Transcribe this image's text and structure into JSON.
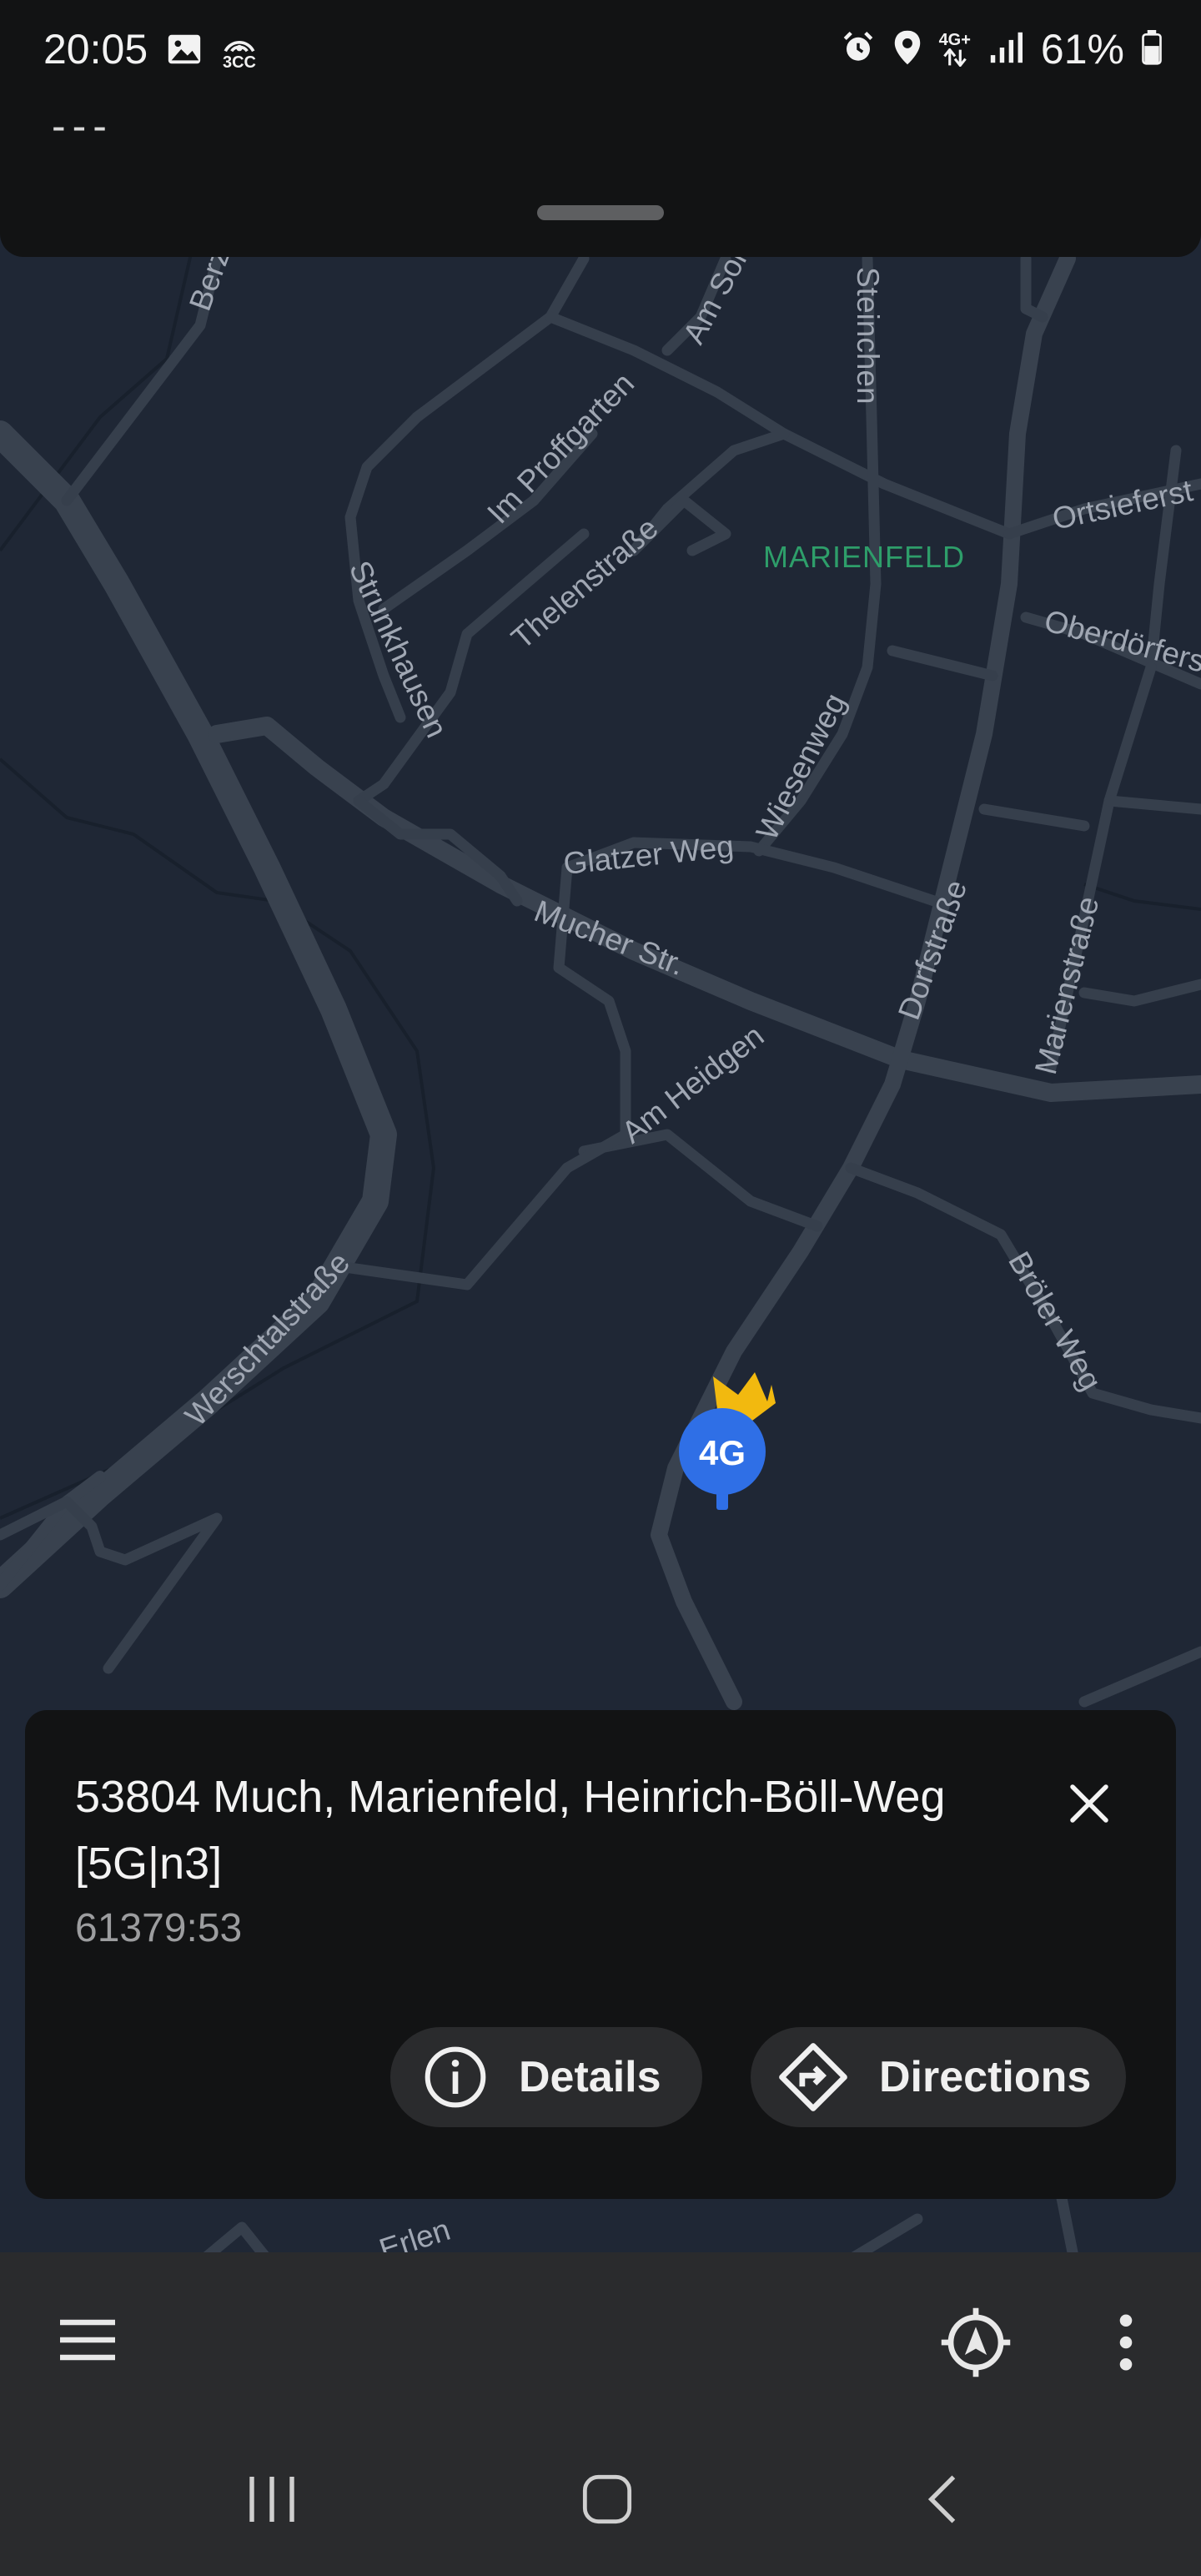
{
  "status_bar": {
    "time": "20:05",
    "left_icons": [
      "gallery-icon",
      "3cc-hotspot-icon"
    ],
    "right_icons": [
      "alarm-icon",
      "location-pin-icon",
      "4g-plus-data-icon",
      "signal-bars-icon"
    ],
    "network_label": "4G+",
    "hotspot_label": "3CC",
    "battery_percent": "61%",
    "battery_level": 0.61
  },
  "top_sheet": {
    "value": "---"
  },
  "map": {
    "background": "#1f2735",
    "road_color": "#3a4350",
    "label_color": "#a0a7b3",
    "place_label": "MARIENFELD",
    "place_color": "#2e9e6a",
    "street_labels": [
      "Berzh",
      "Am Soh",
      "Steinchen",
      "Im Proffgarten",
      "Ortsieferst",
      "Thelenstraße",
      "Strunkhausen",
      "Oberdörfers",
      "Wiesenweg",
      "Glatzer Weg",
      "Mucher Str.",
      "Dorfstraße",
      "Marienstraße",
      "Am Heidgen",
      "Bröler Weg",
      "Werschtalstraße",
      "Erlen"
    ],
    "marker": {
      "label": "4G",
      "color": "#2f6fe6",
      "crown_color": "#f2b90f"
    }
  },
  "info_card": {
    "title": "53804 Much, Marienfeld, Heinrich-Böll-Weg [5G|n3]",
    "subtitle": "61379:53",
    "close_icon": "close-icon",
    "details_label": "Details",
    "details_icon": "info-icon",
    "directions_label": "Directions",
    "directions_icon": "directions-icon"
  },
  "bottom_bar": {
    "menu_icon": "menu-icon",
    "locate_icon": "my-location-icon",
    "more_icon": "more-vert-icon"
  },
  "nav_bar": {
    "recents_icon": "recents-icon",
    "home_icon": "home-icon",
    "back_icon": "back-icon"
  }
}
